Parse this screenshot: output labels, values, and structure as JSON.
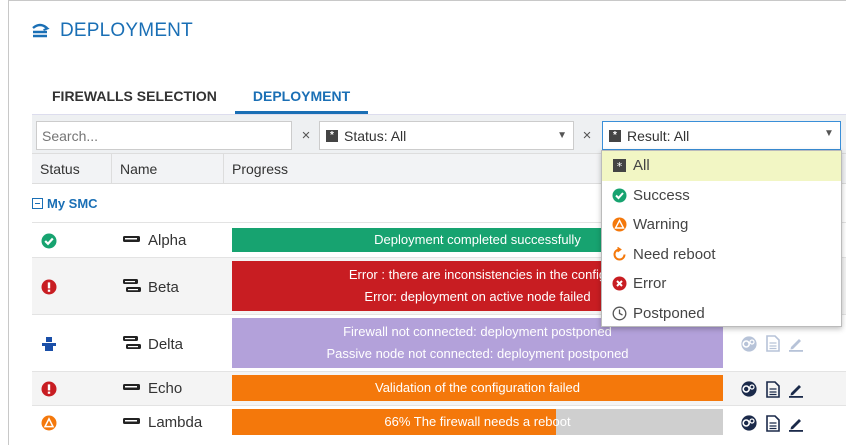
{
  "header": {
    "title": "DEPLOYMENT"
  },
  "tabs": [
    {
      "label": "FIREWALLS SELECTION",
      "active": false
    },
    {
      "label": "DEPLOYMENT",
      "active": true
    }
  ],
  "filters": {
    "search_placeholder": "Search...",
    "clear_glyph": "×",
    "status": {
      "label": "Status: All"
    },
    "result": {
      "label": "Result: All"
    }
  },
  "columns": [
    "Status",
    "Name",
    "Progress"
  ],
  "group": {
    "label": "My SMC"
  },
  "rows": [
    {
      "name": "Alpha",
      "status_icon": "success-icon",
      "lines": [
        "Deployment completed successfully"
      ],
      "bar_color": "#17a370",
      "progress": 1.0
    },
    {
      "name": "Beta",
      "status_icon": "error-icon",
      "lines": [
        "Error : there are inconsistencies in the config",
        "Error: deployment on active node failed"
      ],
      "bar_color": "#c81d22",
      "progress": 1.0
    },
    {
      "name": "Delta",
      "status_icon": "postponed-icon",
      "lines": [
        "Firewall not connected: deployment postponed",
        "Passive node not connected: deployment postponed"
      ],
      "bar_color": "#b3a1da",
      "progress": 1.0
    },
    {
      "name": "Echo",
      "status_icon": "error-icon",
      "lines": [
        "Validation of the configuration failed"
      ],
      "bar_color": "#f4780b",
      "progress": 1.0
    },
    {
      "name": "Lambda",
      "status_icon": "warning-icon",
      "lines": [
        "66% The firewall needs a reboot"
      ],
      "bar_color": "#f4780b",
      "progress": 0.66
    }
  ],
  "result_options": [
    {
      "label": "All",
      "icon": "all-square-icon",
      "selected": true
    },
    {
      "label": "Success",
      "icon": "success-icon",
      "selected": false
    },
    {
      "label": "Warning",
      "icon": "warning-icon",
      "selected": false
    },
    {
      "label": "Need reboot",
      "icon": "reboot-icon",
      "selected": false
    },
    {
      "label": "Error",
      "icon": "error-icon",
      "selected": false
    },
    {
      "label": "Postponed",
      "icon": "postponed-clock-icon",
      "selected": false
    }
  ],
  "colors": {
    "accent": "#1a6fb5",
    "success": "#17a370",
    "error": "#c81d22",
    "warning": "#f4780b"
  }
}
